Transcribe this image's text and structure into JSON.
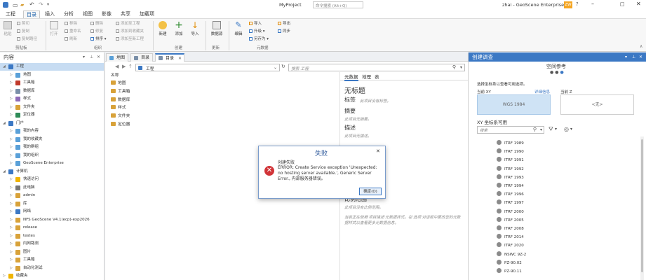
{
  "window": {
    "title": "MyProject",
    "search_placeholder": "命令搜索 (Alt+Q)",
    "user": "zhai - GeoScene Enterprise",
    "user_initials": "ZW"
  },
  "menu": [
    "工程",
    "目录",
    "插入",
    "分析",
    "视图",
    "影像",
    "共享",
    "加载项"
  ],
  "ribbon": {
    "clipboard": {
      "label": "剪贴板",
      "paste": "粘贴",
      "cut": "剪切",
      "copy": "复制",
      "copy_path": "复制路径"
    },
    "organize": {
      "label": "组织",
      "open": "打开",
      "move": "移除",
      "rename": "重命名",
      "refresh": "刷新",
      "delete": "删除",
      "repair": "修复",
      "sort": "排序 ▾",
      "add_project": "添加至工程",
      "add_favorite": "添加到收藏夹",
      "add_new": "添加至新工程"
    },
    "create": {
      "label": "创建",
      "new": "新建",
      "add": "添加",
      "import": "导入"
    },
    "update": {
      "label": "更新",
      "data_source": "数据源"
    },
    "metadata": {
      "label": "元数据",
      "edit": "编辑",
      "import": "导入",
      "upgrade": "升级 ▾",
      "save_as": "另存为 ▾",
      "export": "导出",
      "sync": "同步"
    }
  },
  "left_pane": {
    "title": "内容",
    "items": [
      {
        "label": "工程",
        "level": 0,
        "expanded": true,
        "selected": true,
        "icon": "project"
      },
      {
        "label": "地图",
        "level": 1,
        "icon": "map"
      },
      {
        "label": "工具箱",
        "level": 1,
        "icon": "toolbox"
      },
      {
        "label": "数据库",
        "level": 1,
        "icon": "database"
      },
      {
        "label": "样式",
        "level": 1,
        "icon": "style"
      },
      {
        "label": "文件夹",
        "level": 1,
        "icon": "folder"
      },
      {
        "label": "定位器",
        "level": 1,
        "icon": "locator"
      },
      {
        "label": "门户",
        "level": 0,
        "expanded": true,
        "icon": "portal"
      },
      {
        "label": "我的内容",
        "level": 1,
        "icon": "cloud"
      },
      {
        "label": "我的收藏夹",
        "level": 1,
        "icon": "cloud"
      },
      {
        "label": "我的群组",
        "level": 1,
        "icon": "cloud"
      },
      {
        "label": "我的组织",
        "level": 1,
        "icon": "cloud"
      },
      {
        "label": "GeoScene Enterprise",
        "level": 1,
        "icon": "cloud"
      },
      {
        "label": "计算机",
        "level": 0,
        "expanded": true,
        "icon": "computer"
      },
      {
        "label": "快速访问",
        "level": 1,
        "icon": "star"
      },
      {
        "label": "此电脑",
        "level": 1,
        "icon": "drive"
      },
      {
        "label": "admin",
        "level": 1,
        "icon": "user"
      },
      {
        "label": "库",
        "level": 1,
        "icon": "library"
      },
      {
        "label": "网络",
        "level": 1,
        "icon": "network"
      },
      {
        "label": "NFS GeoScene V4.1(ecp)-exp2026",
        "level": 1,
        "icon": "folder"
      },
      {
        "label": "release",
        "level": 1,
        "icon": "folder"
      },
      {
        "label": "testes",
        "level": 1,
        "icon": "folder"
      },
      {
        "label": "内网路测",
        "level": 1,
        "icon": "folder"
      },
      {
        "label": "图片",
        "level": 1,
        "icon": "folder"
      },
      {
        "label": "工具箱",
        "level": 1,
        "icon": "folder"
      },
      {
        "label": "自动化测试",
        "level": 1,
        "icon": "folder"
      },
      {
        "label": "收藏夹",
        "level": 0,
        "icon": "star"
      }
    ]
  },
  "center": {
    "tabs": [
      {
        "label": "地图",
        "active": false
      },
      {
        "label": "目录",
        "active": false
      },
      {
        "label": "目录",
        "active": true
      }
    ],
    "address": {
      "path": "工程",
      "search_placeholder": "搜索 工程"
    },
    "list_header": "名称",
    "items": [
      "地图",
      "工具箱",
      "数据库",
      "样式",
      "文件夹",
      "定位器"
    ],
    "metadata": {
      "tabs": [
        "元数据",
        "地理",
        "表"
      ],
      "title": "无标题",
      "tags_label": "标签",
      "tags_value": "此项目没有标签。",
      "summary_label": "摘要",
      "summary_value": "此项目无摘要。",
      "desc_label": "描述",
      "desc_value": "此项目无描述。",
      "scale_label": "比例范围",
      "scale_value": "此项目没有比例范围。",
      "note": "当前正在使用'项目描述'元数据样式。在'选项'对话框中更改您的元数据样式以查看更多元数据信息。"
    }
  },
  "dialog": {
    "title": "失败",
    "heading": "创建失败",
    "message": "ERROR: Create Service exception 'Unexpected: no hosting server available.', Generic Server Error., 内部服务器错误。",
    "ok": "确定(O)"
  },
  "right_pane": {
    "title": "创建调查",
    "section_title": "空间参考",
    "instruction": "选择坐标系以查看可用选项。",
    "current_xy_label": "当前 XY",
    "current_xy_link": "详细信息",
    "current_xy_value": "WGS 1984",
    "current_z_label": "当前 Z",
    "current_z_value": "<无>",
    "xy_available_label": "XY 坐标系可用",
    "search_placeholder": "搜索",
    "coordinate_systems": [
      "ITRF 1989",
      "ITRF 1990",
      "ITRF 1991",
      "ITRF 1992",
      "ITRF 1993",
      "ITRF 1994",
      "ITRF 1996",
      "ITRF 1997",
      "ITRF 2000",
      "ITRF 2005",
      "ITRF 2008",
      "ITRF 2014",
      "ITRF 2020",
      "NSWC 9Z-2",
      "PZ-90.02",
      "PZ-90.11"
    ]
  },
  "colors": {
    "accent": "#3b78c4",
    "error": "#d13438",
    "selection": "#c7dcf2",
    "folder": "#d8a23a"
  }
}
